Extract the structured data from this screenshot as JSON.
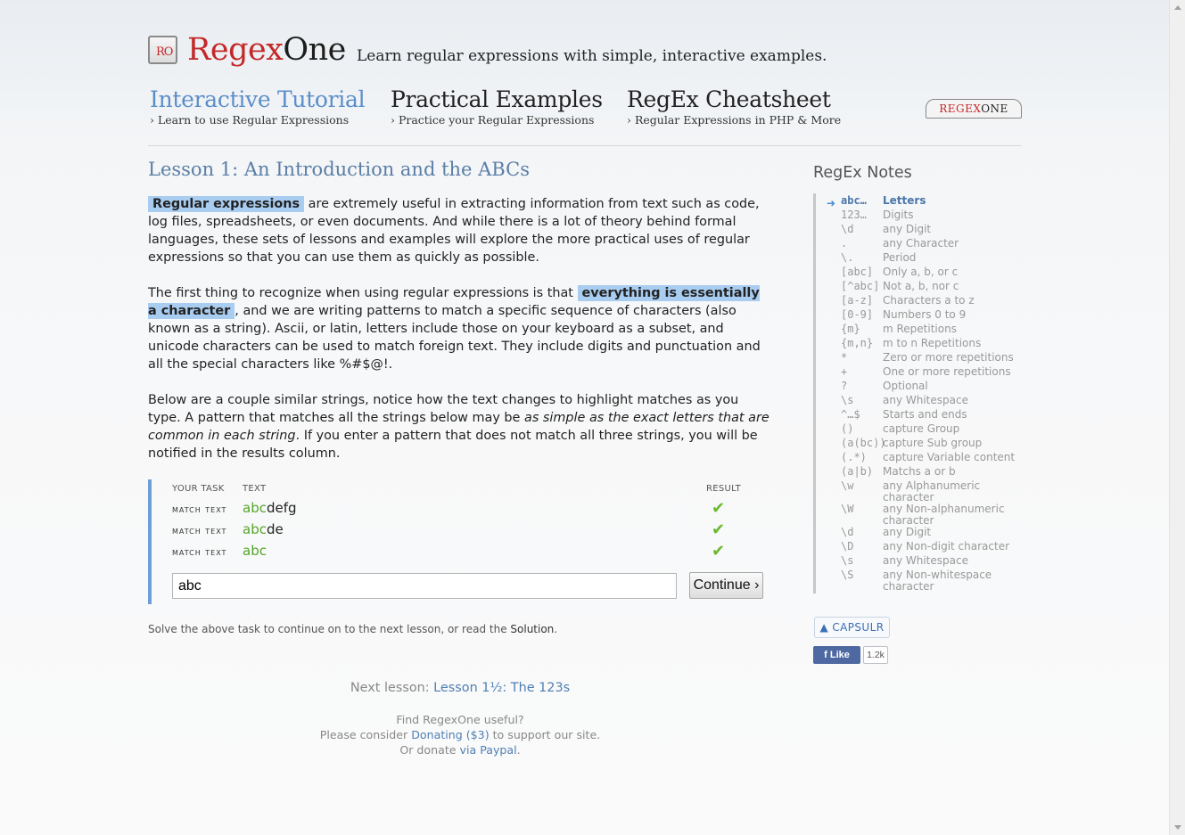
{
  "header": {
    "logo_badge": "RO",
    "logo_a": "Regex",
    "logo_b": "One",
    "tagline": "Learn regular expressions with simple, interactive examples."
  },
  "nav": [
    {
      "title": "Interactive Tutorial",
      "sub": "› Learn to use Regular Expressions"
    },
    {
      "title": "Practical Examples",
      "sub": "› Practice your Regular Expressions"
    },
    {
      "title": "RegEx Cheatsheet",
      "sub": "› Regular Expressions in PHP & More"
    }
  ],
  "badge": {
    "a": "REGEX",
    "b": "ONE"
  },
  "lesson": {
    "title": "Lesson 1: An Introduction and the ABCs",
    "p1_hl": "Regular expressions",
    "p1_rest": " are extremely useful in extracting information from text such as code, log files, spreadsheets, or even documents. And while there is a lot of theory behind formal languages, these sets of lessons and examples will explore the more practical uses of regular expressions so that you can use them as quickly as possible.",
    "p2_a": "The first thing to recognize when using regular expressions is that ",
    "p2_hl": "everything is essentially a character",
    "p2_b": ", and we are writing patterns to match a specific sequence of characters (also known as a string). Ascii, or latin, letters include those on your keyboard as a subset, and unicode characters can be used to match foreign text. They include digits and punctuation and all the special characters like %#$@!.",
    "p3_a": "Below are a couple similar strings, notice how the text changes to highlight matches as you type. A pattern that matches all the strings below may be ",
    "p3_em": "as simple as the exact letters that are common in each string",
    "p3_b": ". If you enter a pattern that does not match all three strings, you will be notified in the results column."
  },
  "task": {
    "col_task": "YOUR TASK",
    "col_text": "TEXT",
    "col_result": "RESULT",
    "rows": [
      {
        "task": "match text",
        "match": "abc",
        "rest": "defg",
        "result": "✔"
      },
      {
        "task": "match text",
        "match": "abc",
        "rest": "de",
        "result": "✔"
      },
      {
        "task": "match text",
        "match": "abc",
        "rest": "",
        "result": "✔"
      }
    ],
    "input_value": "abc",
    "continue_label": "Continue ›"
  },
  "solve": {
    "text": "Solve the above task to continue on to the next lesson, or read the ",
    "link": "Solution",
    "end": "."
  },
  "next": {
    "label": "Next lesson: ",
    "link": "Lesson 1½: The 123s"
  },
  "donate": {
    "line1": "Find RegexOne useful?",
    "line2a": "Please consider ",
    "line2_link": "Donating ($3)",
    "line2b": " to support our site.",
    "line3a": "Or donate ",
    "line3_link": "via Paypal",
    "line3b": "."
  },
  "notes": {
    "title": "RegEx Notes",
    "items": [
      {
        "k": "abc…",
        "v": "Letters"
      },
      {
        "k": "123…",
        "v": "Digits"
      },
      {
        "k": "\\d",
        "v": "any Digit"
      },
      {
        "k": ".",
        "v": "any Character"
      },
      {
        "k": "\\.",
        "v": "Period"
      },
      {
        "k": "[abc]",
        "v": "Only a, b, or c"
      },
      {
        "k": "[^abc]",
        "v": "Not a, b, nor c"
      },
      {
        "k": "[a-z]",
        "v": "Characters a to z"
      },
      {
        "k": "[0-9]",
        "v": "Numbers 0 to 9"
      },
      {
        "k": "{m}",
        "v": "m Repetitions"
      },
      {
        "k": "{m,n}",
        "v": "m to n Repetitions"
      },
      {
        "k": "*",
        "v": "Zero or more repetitions"
      },
      {
        "k": "+",
        "v": "One or more repetitions"
      },
      {
        "k": "?",
        "v": "Optional"
      },
      {
        "k": "\\s",
        "v": "any Whitespace"
      },
      {
        "k": "^…$",
        "v": "Starts and ends"
      },
      {
        "k": "()",
        "v": "capture Group"
      },
      {
        "k": "(a(bc))",
        "v": "capture Sub group"
      },
      {
        "k": "(.*)",
        "v": "capture Variable content"
      },
      {
        "k": "(a|b)",
        "v": "Matchs a or b"
      },
      {
        "k": "\\w",
        "v": "any Alphanumeric character"
      },
      {
        "k": "\\W",
        "v": "any Non-alphanumeric character"
      },
      {
        "k": "\\d",
        "v": "any Digit"
      },
      {
        "k": "\\D",
        "v": "any Non-digit character"
      },
      {
        "k": "\\s",
        "v": "any Whitespace"
      },
      {
        "k": "\\S",
        "v": "any Non-whitespace character"
      }
    ]
  },
  "capsulr": "CAPSULR",
  "fb": {
    "like": "Like",
    "count": "1.2k"
  },
  "colors": {
    "accent": "#5b8ec9",
    "highlight": "#a9cdf1",
    "match": "#55a52a",
    "brand_red": "#c42828"
  }
}
